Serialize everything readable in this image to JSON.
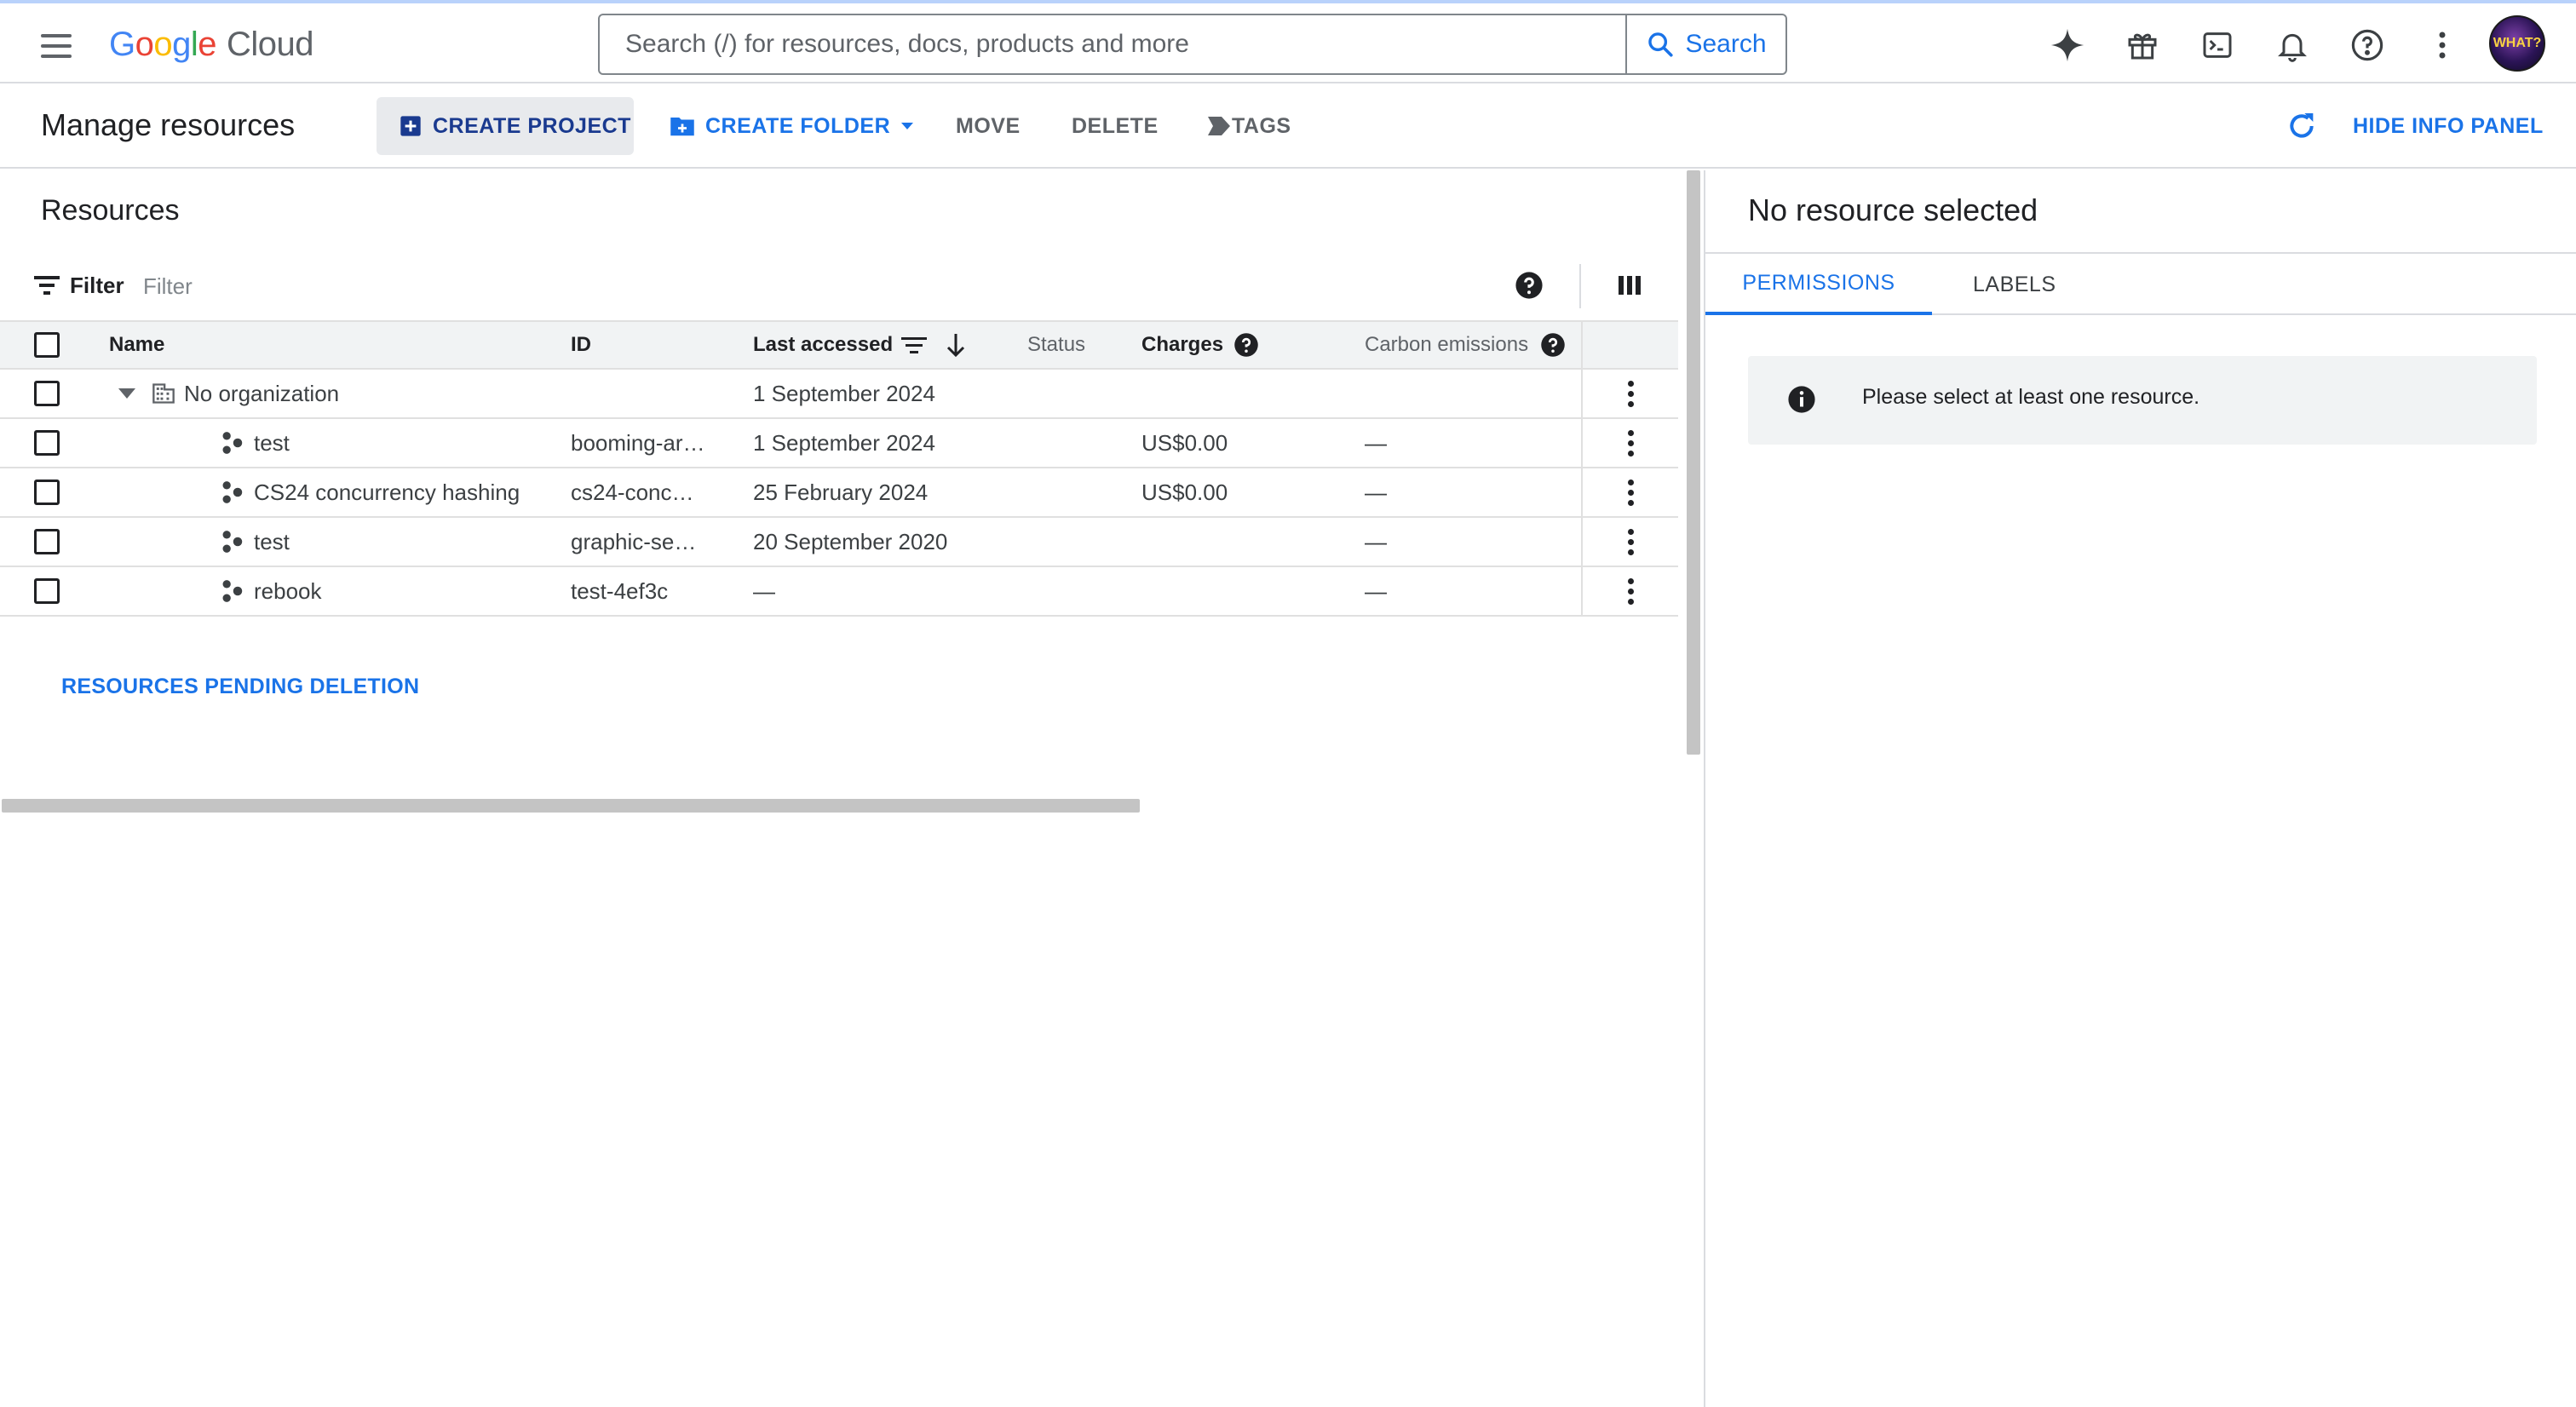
{
  "colors": {
    "accent": "#1a73e8",
    "primary_button_text": "#1a3a8f",
    "icon": "#5f6368",
    "border": "#dadce0"
  },
  "header": {
    "menu_icon": "hamburger-icon",
    "logo_google": [
      "G",
      "o",
      "o",
      "g",
      "l",
      "e"
    ],
    "logo_cloud": "Cloud",
    "search_placeholder": "Search (/) for resources, docs, products and more",
    "search_button": "Search",
    "icons": [
      "gemini-sparkle-icon",
      "gift-icon",
      "cloud-shell-icon",
      "notifications-bell-icon",
      "help-icon",
      "more-vert-icon"
    ],
    "avatar_text": "WHAT?"
  },
  "toolbar": {
    "title": "Manage resources",
    "create_project": "CREATE PROJECT",
    "create_folder": "CREATE FOLDER",
    "move": "MOVE",
    "delete": "DELETE",
    "tags": "TAGS",
    "hide_info": "HIDE INFO PANEL"
  },
  "resources": {
    "title": "Resources",
    "filter_label": "Filter",
    "filter_placeholder": "Filter",
    "columns": {
      "name": "Name",
      "id": "ID",
      "last_accessed": "Last accessed",
      "status": "Status",
      "charges": "Charges",
      "carbon": "Carbon emissions"
    },
    "rows": [
      {
        "name": "No organization",
        "id": "",
        "last": "1 September 2024",
        "status": "",
        "charges": "",
        "carbon": ""
      },
      {
        "name": "test",
        "id": "booming-ar…",
        "last": "1 September 2024",
        "status": "",
        "charges": "US$0.00",
        "carbon": "—"
      },
      {
        "name": "CS24 concurrency hashing",
        "id": "cs24-conc…",
        "last": "25 February 2024",
        "status": "",
        "charges": "US$0.00",
        "carbon": "—"
      },
      {
        "name": "test",
        "id": "graphic-se…",
        "last": "20 September 2020",
        "status": "",
        "charges": "",
        "carbon": "—"
      },
      {
        "name": "rebook",
        "id": "test-4ef3c",
        "last": "—",
        "status": "",
        "charges": "",
        "carbon": "—"
      }
    ],
    "pending_link": "RESOURCES PENDING DELETION"
  },
  "info_panel": {
    "title": "No resource selected",
    "tabs": [
      "PERMISSIONS",
      "LABELS"
    ],
    "message": "Please select at least one resource."
  }
}
